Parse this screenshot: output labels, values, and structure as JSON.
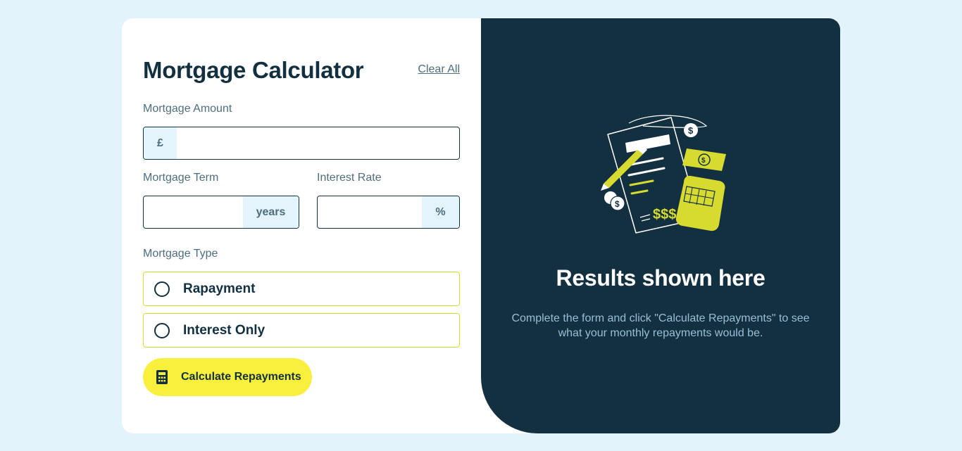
{
  "form": {
    "title": "Mortgage Calculator",
    "clear_all": "Clear All",
    "amount": {
      "label": "Mortgage Amount",
      "prefix": "£",
      "value": ""
    },
    "term": {
      "label": "Mortgage Term",
      "suffix": "years",
      "value": ""
    },
    "rate": {
      "label": "Interest Rate",
      "suffix": "%",
      "value": ""
    },
    "type": {
      "label": "Mortgage Type",
      "options": [
        {
          "label": "Rapayment",
          "selected": false
        },
        {
          "label": "Interest Only",
          "selected": false
        }
      ]
    },
    "submit_label": "Calculate Repayments"
  },
  "results": {
    "title": "Results shown here",
    "description": "Complete the form and click \"Calculate Repayments\" to see what your monthly repayments would be.",
    "illustration": "calculator-illustration",
    "illustration_text": "$$$"
  },
  "colors": {
    "background": "#e3f3fc",
    "dark": "#133041",
    "accent": "#d8db2f",
    "button": "#f8f03c",
    "muted": "#4e6e7e"
  }
}
